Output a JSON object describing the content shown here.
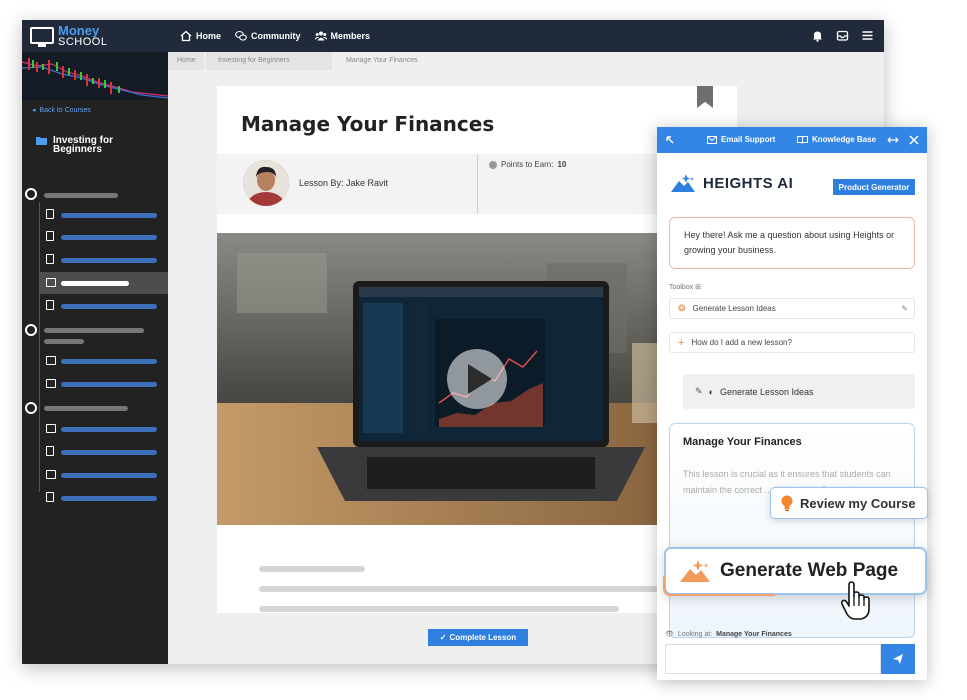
{
  "app": {
    "logo_line1": "Money",
    "logo_line2": "SCHOOL"
  },
  "nav": {
    "home": "Home",
    "community": "Community",
    "members": "Members"
  },
  "sidebar": {
    "back_label": "Back to Courses",
    "course_title": "Investing for Beginners"
  },
  "breadcrumb": {
    "home": "Home",
    "course": "Investing for Beginners",
    "current": "Manage Your Finances"
  },
  "lesson": {
    "title": "Manage Your Finances",
    "author": "Lesson By: Jake Ravit",
    "points_label": "Points to Earn:",
    "points_value": "10",
    "complete_label": "Complete Lesson"
  },
  "ai_panel": {
    "email_support": "Email Support",
    "knowledge_base": "Knowledge Base",
    "brand": "HEIGHTS AI",
    "product_generator": "Product Generator",
    "greeting": "Hey there! Ask me a question about using Heights or growing your business.",
    "toolbox_label": "Toolbox",
    "tool_1": "Generate Lesson Ideas",
    "tool_2": "How do I add a new lesson?",
    "generate_button": "Generate Lesson Ideas",
    "doc_title": "Manage Your Finances",
    "doc_body": "This lesson is crucial as it ensures that students can maintain the correct ... their guide: Procedure...",
    "looking_label": "Looking at:",
    "looking_value": "Manage Your Finances",
    "input_placeholder": ""
  },
  "callouts": {
    "review": "Review my Course",
    "generate_web": "Generate Web Page"
  },
  "colors": {
    "accent": "#3386e6",
    "nav_bg": "#202a3a",
    "sidebar_bg": "#222222",
    "warm_accent": "#f3a26e"
  }
}
